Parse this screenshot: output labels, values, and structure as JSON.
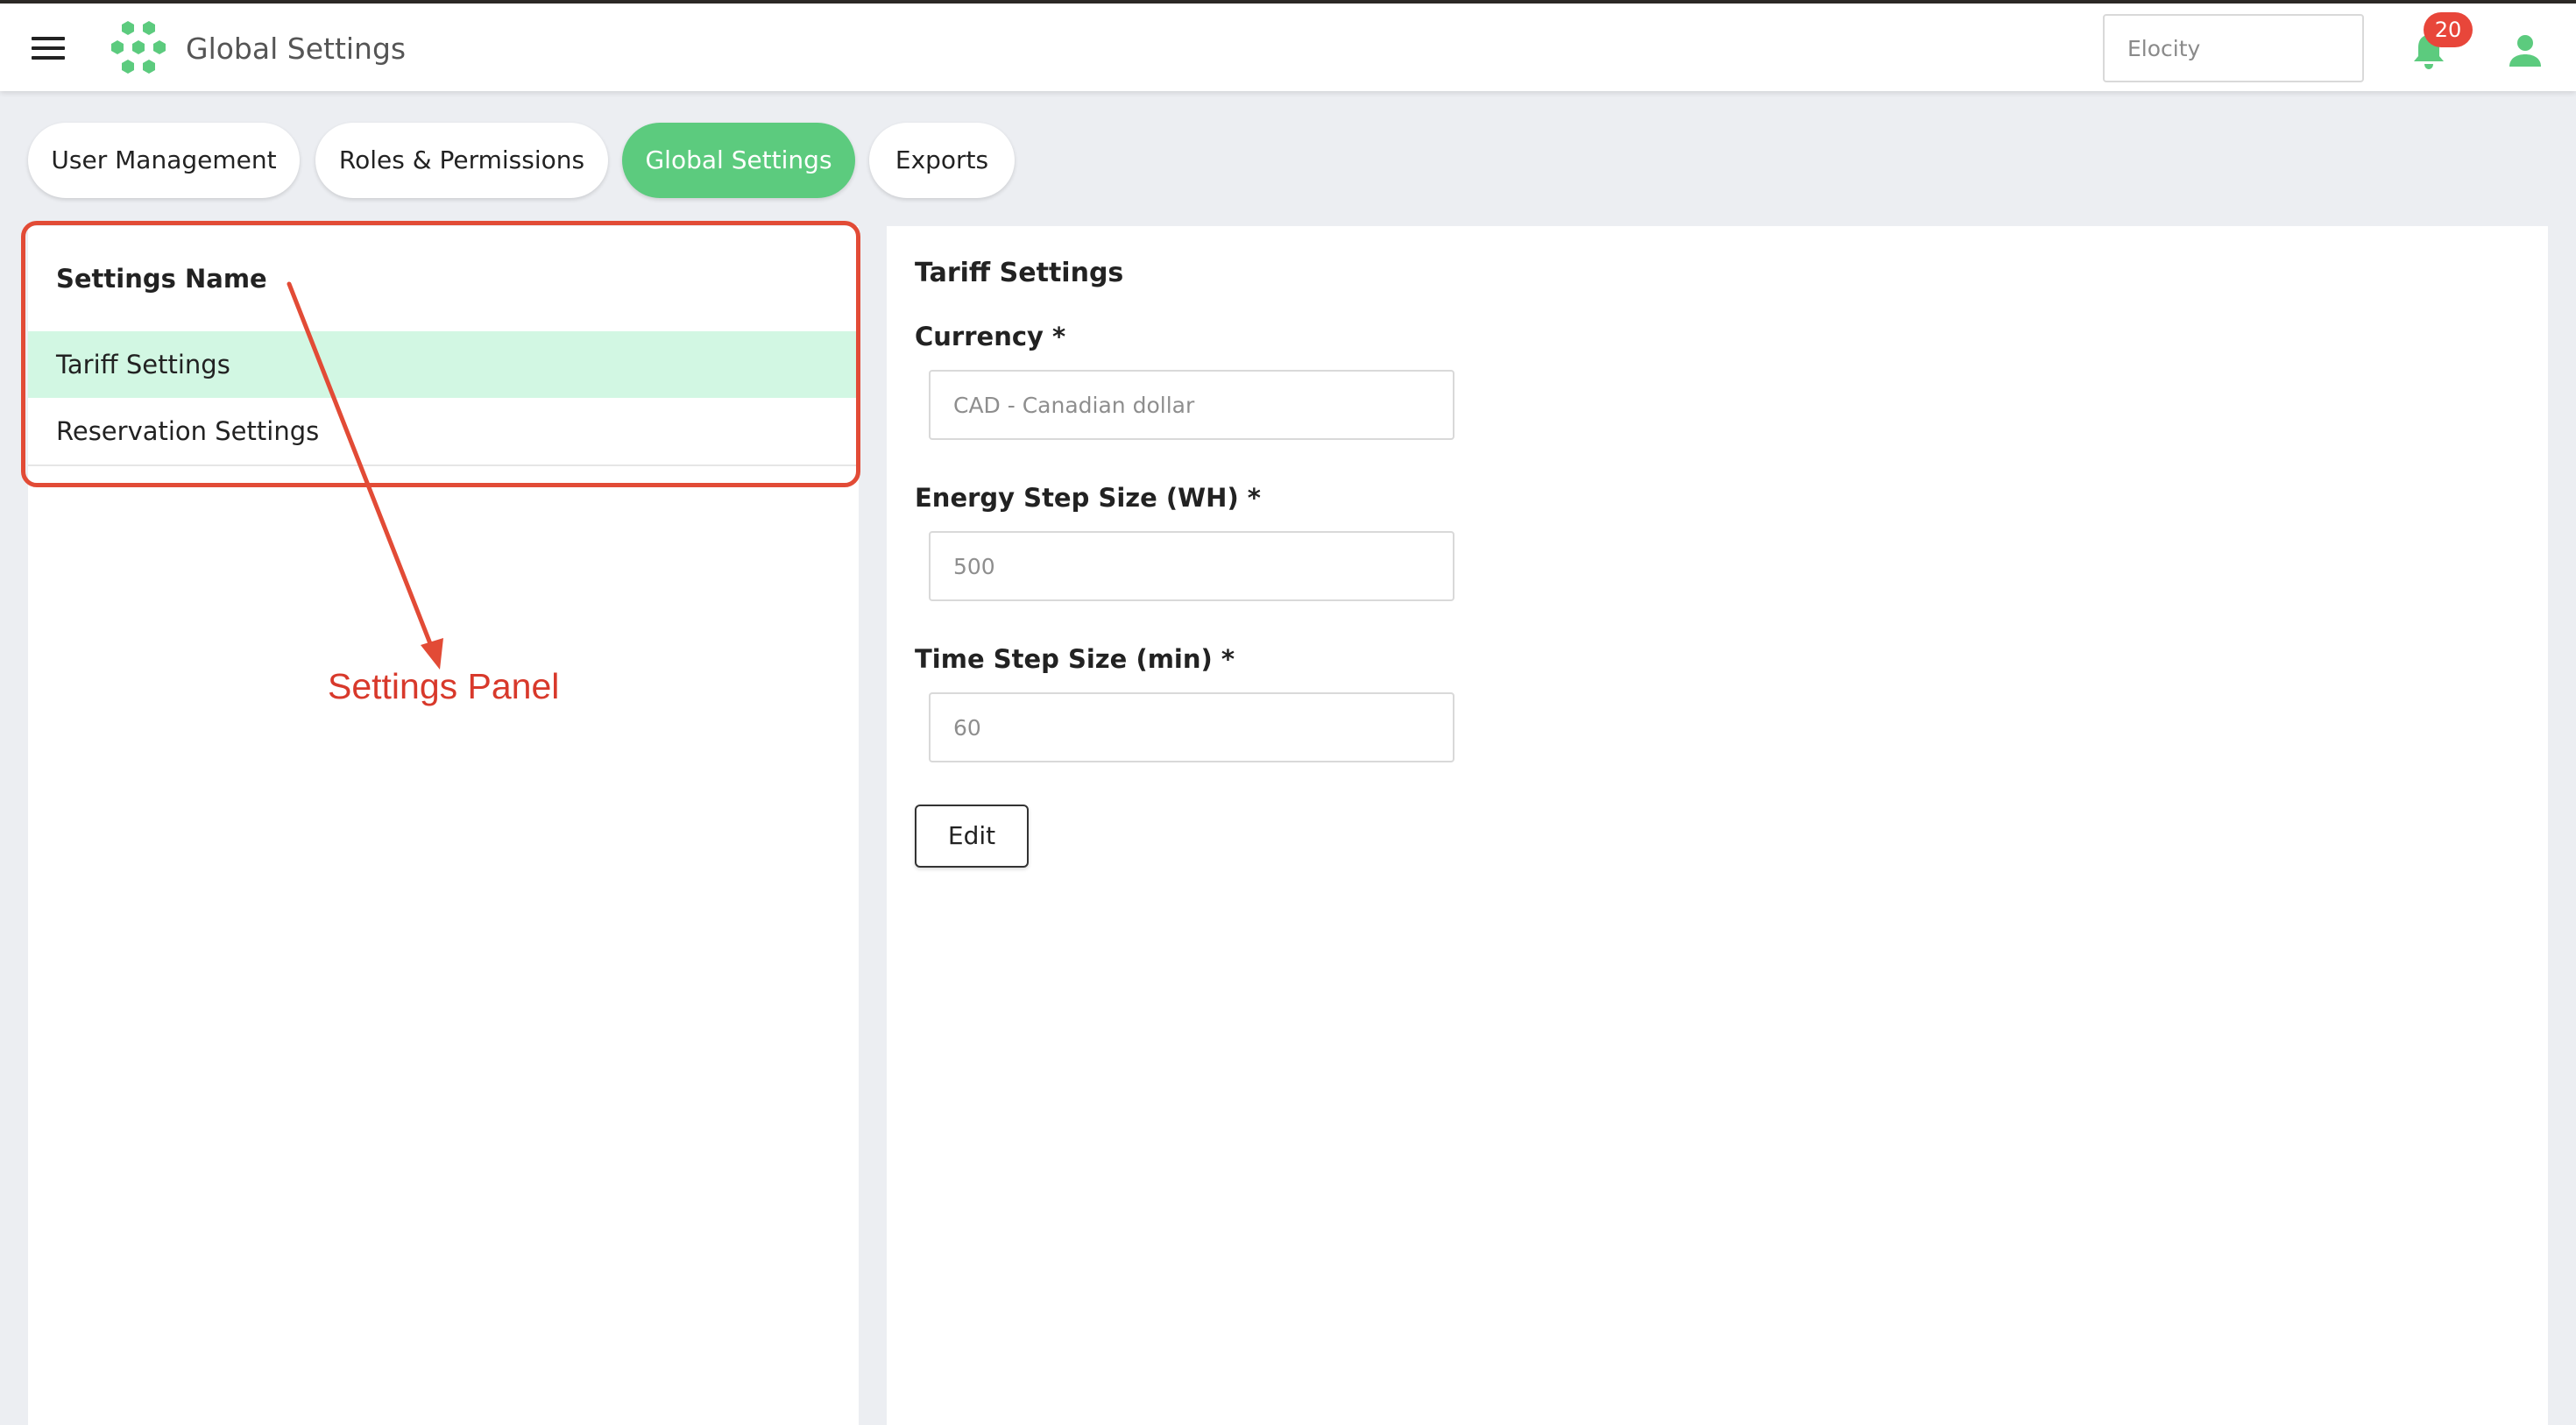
{
  "header": {
    "app_title": "Global Settings",
    "tenant_selector": "Elocity",
    "notification_count": "20",
    "icons": [
      "menu-icon",
      "hexagon-logo-icon",
      "bell-icon",
      "user-icon"
    ]
  },
  "tabs": [
    {
      "label": "User Management",
      "active": false
    },
    {
      "label": "Roles & Permissions",
      "active": false
    },
    {
      "label": "Global Settings",
      "active": true
    },
    {
      "label": "Exports",
      "active": false
    }
  ],
  "settings_panel": {
    "heading": "Settings Name",
    "items": [
      {
        "label": "Tariff Settings",
        "selected": true
      },
      {
        "label": "Reservation Settings",
        "selected": false
      }
    ]
  },
  "tariff_settings": {
    "title": "Tariff Settings",
    "fields": [
      {
        "label": "Currency *",
        "value": "CAD - Canadian dollar"
      },
      {
        "label": "Energy Step Size (WH) *",
        "value": "500"
      },
      {
        "label": "Time Step Size (min) *",
        "value": "60"
      }
    ],
    "edit_label": "Edit"
  },
  "annotation": {
    "label": "Settings Panel"
  },
  "colors": {
    "brand_green": "#5ccb7e",
    "selected_row": "#d2f7e3",
    "badge_red": "#e8463a",
    "annotation_red": "#e24b36",
    "page_background": "#eceef2"
  }
}
